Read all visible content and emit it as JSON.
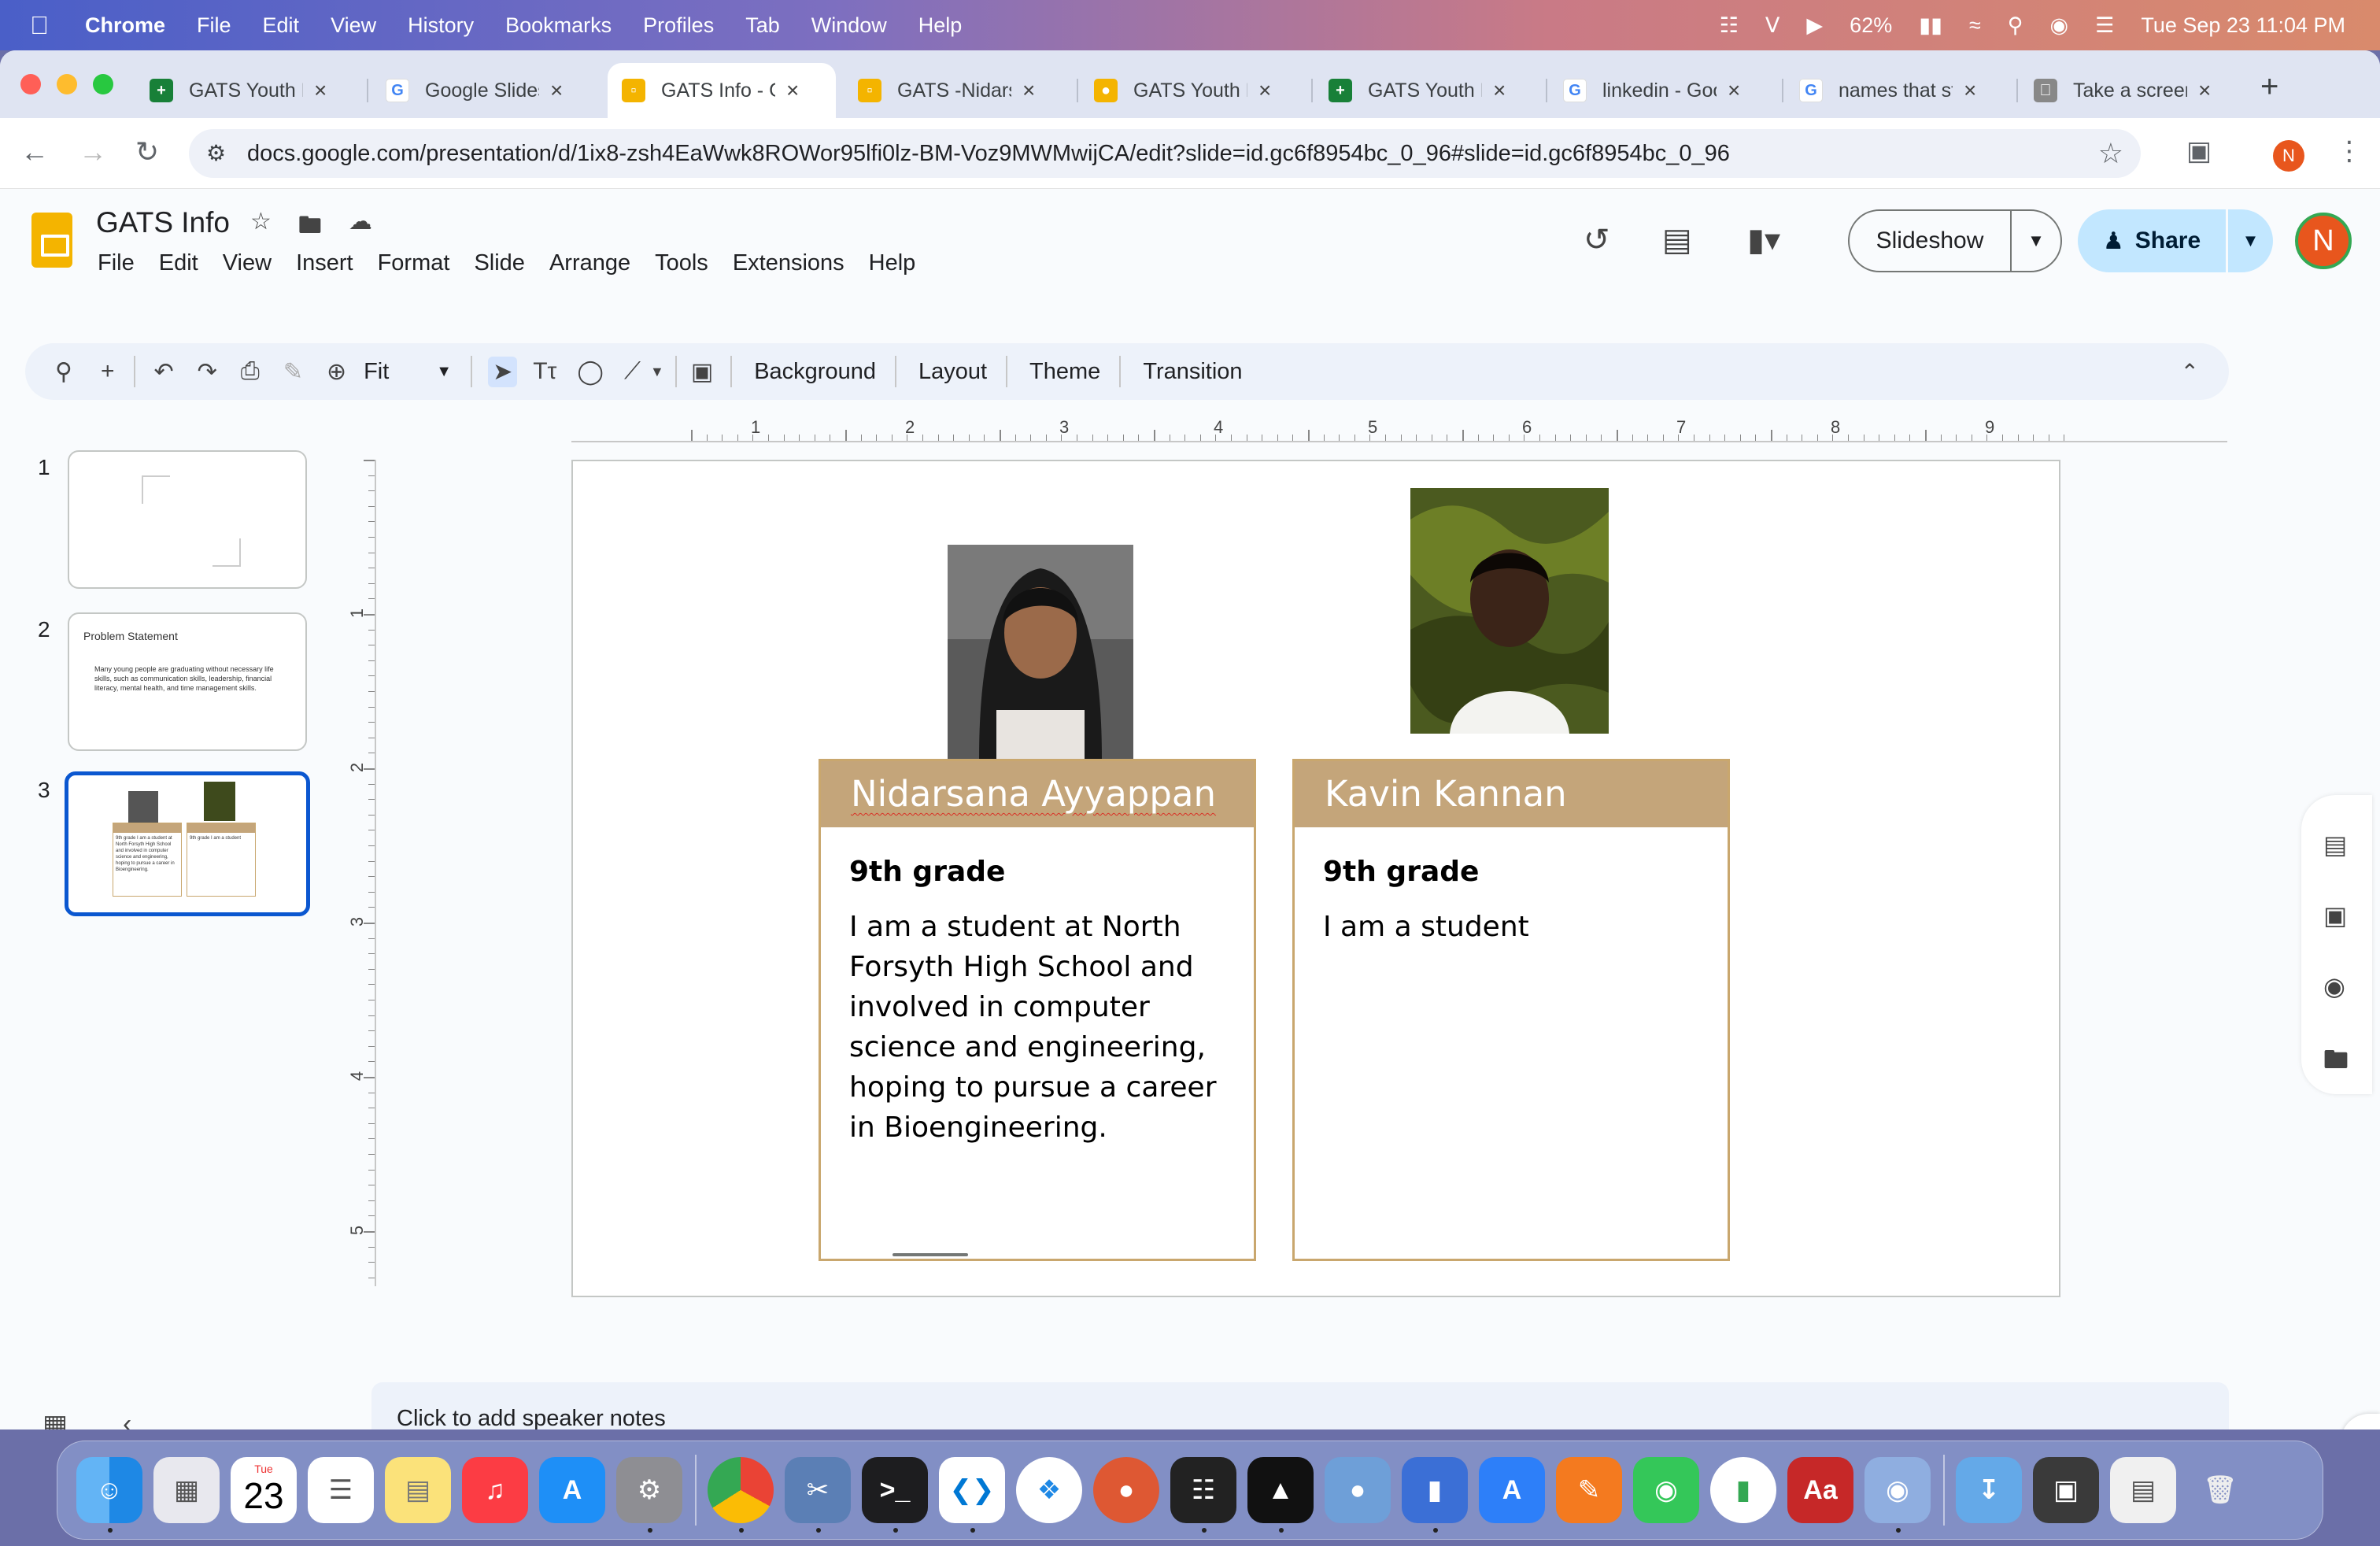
{
  "menubar": {
    "app_name": "Chrome",
    "items": [
      "File",
      "Edit",
      "View",
      "History",
      "Bookmarks",
      "Profiles",
      "Tab",
      "Window",
      "Help"
    ],
    "battery": "62%",
    "datetime": "Tue Sep 23  11:04 PM"
  },
  "browser": {
    "tabs": [
      {
        "label": "GATS Youth Le",
        "icon": "sheets-icon",
        "color": "#188038",
        "active": false
      },
      {
        "label": "Google Slides",
        "icon": "google-icon",
        "color": "#4285f4",
        "active": false
      },
      {
        "label": "GATS Info - G",
        "icon": "slides-icon",
        "color": "#f4b400",
        "active": true
      },
      {
        "label": "GATS -Nidars",
        "icon": "slides-icon",
        "color": "#f4b400",
        "active": false
      },
      {
        "label": "GATS Youth L",
        "icon": "classroom-icon",
        "color": "#f4b400",
        "active": false
      },
      {
        "label": "GATS Youth L",
        "icon": "sheets-icon",
        "color": "#188038",
        "active": false
      },
      {
        "label": "linkedin - Goo",
        "icon": "google-icon",
        "color": "#4285f4",
        "active": false
      },
      {
        "label": "names that st",
        "icon": "google-icon",
        "color": "#4285f4",
        "active": false
      },
      {
        "label": "Take a screen",
        "icon": "apple-icon",
        "color": "#555555",
        "active": false
      }
    ],
    "url": "docs.google.com/presentation/d/1ix8-zsh4EaWwk8ROWor95lfi0lz-BM-Voz9MWMwijCA/edit?slide=id.gc6f8954bc_0_96#slide=id.gc6f8954bc_0_96",
    "profile_initial": "N"
  },
  "app": {
    "doc_title": "GATS Info",
    "menus": [
      "File",
      "Edit",
      "View",
      "Insert",
      "Format",
      "Slide",
      "Arrange",
      "Tools",
      "Extensions",
      "Help"
    ],
    "slideshow_label": "Slideshow",
    "share_label": "Share",
    "avatar_initial": "N",
    "accent_color": "#c2e7ff"
  },
  "toolbar": {
    "zoom_label": "Fit",
    "background_label": "Background",
    "layout_label": "Layout",
    "theme_label": "Theme",
    "transition_label": "Transition"
  },
  "filmstrip": {
    "slides": [
      {
        "number": "1"
      },
      {
        "number": "2",
        "title": "Problem Statement",
        "body": "Many young people are graduating without necessary life skills, such as communication skills, leadership, financial literacy, mental health, and time management skills."
      },
      {
        "number": "3"
      }
    ],
    "slide3_cards": [
      {
        "name": "Nidarsana Ayyappan",
        "text": "9th grade I am a student at North Forsyth High School and involved in computer science and engineering, hoping to pursue a career in Bioengineering."
      },
      {
        "name": "Kavin Kannan",
        "text": "9th grade I am a student"
      }
    ]
  },
  "ruler": {
    "h_labels": [
      "1",
      "2",
      "3",
      "4",
      "5",
      "6",
      "7",
      "8",
      "9"
    ],
    "v_labels": [
      "1",
      "2",
      "3",
      "4",
      "5"
    ]
  },
  "slide": {
    "cards": [
      {
        "name": "Nidarsana Ayyappan",
        "grade": "9th grade",
        "bio": "I am a student at North Forsyth High School and involved in computer science and engineering, hoping to pursue a career in Bioengineering."
      },
      {
        "name": "Kavin Kannan",
        "grade": "9th grade",
        "bio": "I am a student"
      }
    ],
    "card_header_color": "#c4a57a",
    "card_border_color": "#c9a76e"
  },
  "notes": {
    "placeholder": "Click to add speaker notes"
  },
  "dock": {
    "calendar_month": "Tue",
    "calendar_day": "23"
  }
}
